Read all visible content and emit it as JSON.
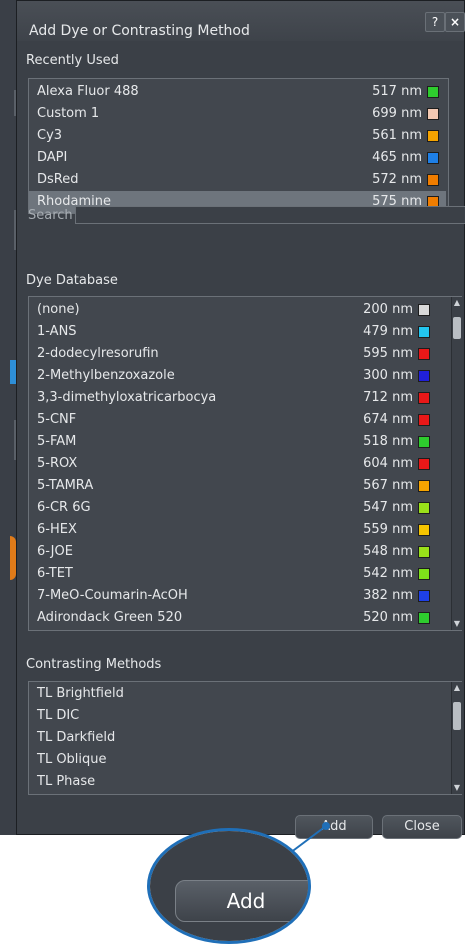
{
  "dialog": {
    "title": "Add Dye or Contrasting Method",
    "help_label": "?",
    "close_label": "×"
  },
  "recently_used": {
    "label": "Recently Used",
    "items": [
      {
        "name": "Alexa Fluor 488",
        "nm": "517 nm",
        "color": "#2ecc2e"
      },
      {
        "name": "Custom 1",
        "nm": "699 nm",
        "color": "#f4c9b3"
      },
      {
        "name": "Cy3",
        "nm": "561 nm",
        "color": "#f5a300"
      },
      {
        "name": "DAPI",
        "nm": "465 nm",
        "color": "#1e7fe6"
      },
      {
        "name": "DsRed",
        "nm": "572 nm",
        "color": "#f07d00"
      },
      {
        "name": "Rhodamine",
        "nm": "575 nm",
        "color": "#f07d00",
        "selected": true
      }
    ]
  },
  "search": {
    "label": "Search",
    "value": ""
  },
  "dye_database": {
    "label": "Dye Database",
    "items": [
      {
        "name": "(none)",
        "nm": "200 nm",
        "color": "#d9d9d9"
      },
      {
        "name": "1-ANS",
        "nm": "479 nm",
        "color": "#23c6f0"
      },
      {
        "name": "2-dodecylresorufin",
        "nm": "595 nm",
        "color": "#e81818"
      },
      {
        "name": "2-Methylbenzoxazole",
        "nm": "300 nm",
        "color": "#2020d8"
      },
      {
        "name": "3,3-dimethyloxatricarbocya",
        "nm": "712 nm",
        "color": "#e81818"
      },
      {
        "name": "5-CNF",
        "nm": "674 nm",
        "color": "#e81818"
      },
      {
        "name": "5-FAM",
        "nm": "518 nm",
        "color": "#2ecc2e"
      },
      {
        "name": "5-ROX",
        "nm": "604 nm",
        "color": "#e81818"
      },
      {
        "name": "5-TAMRA",
        "nm": "567 nm",
        "color": "#f5a300"
      },
      {
        "name": "6-CR 6G",
        "nm": "547 nm",
        "color": "#9ae01a"
      },
      {
        "name": "6-HEX",
        "nm": "559 nm",
        "color": "#f5c400"
      },
      {
        "name": "6-JOE",
        "nm": "548 nm",
        "color": "#9ae01a"
      },
      {
        "name": "6-TET",
        "nm": "542 nm",
        "color": "#7ee01a"
      },
      {
        "name": "7-MeO-Coumarin-AcOH",
        "nm": "382 nm",
        "color": "#1e40e6"
      },
      {
        "name": "Adirondack Green 520",
        "nm": "520 nm",
        "color": "#2ecc2e"
      }
    ]
  },
  "contrasting_methods": {
    "label": "Contrasting Methods",
    "items": [
      "TL Brightfield",
      "TL DIC",
      "TL Darkfield",
      "TL Oblique",
      "TL Phase"
    ]
  },
  "buttons": {
    "add_label": "Add",
    "close_label": "Close"
  },
  "zoom_callout": {
    "label": "Add"
  }
}
